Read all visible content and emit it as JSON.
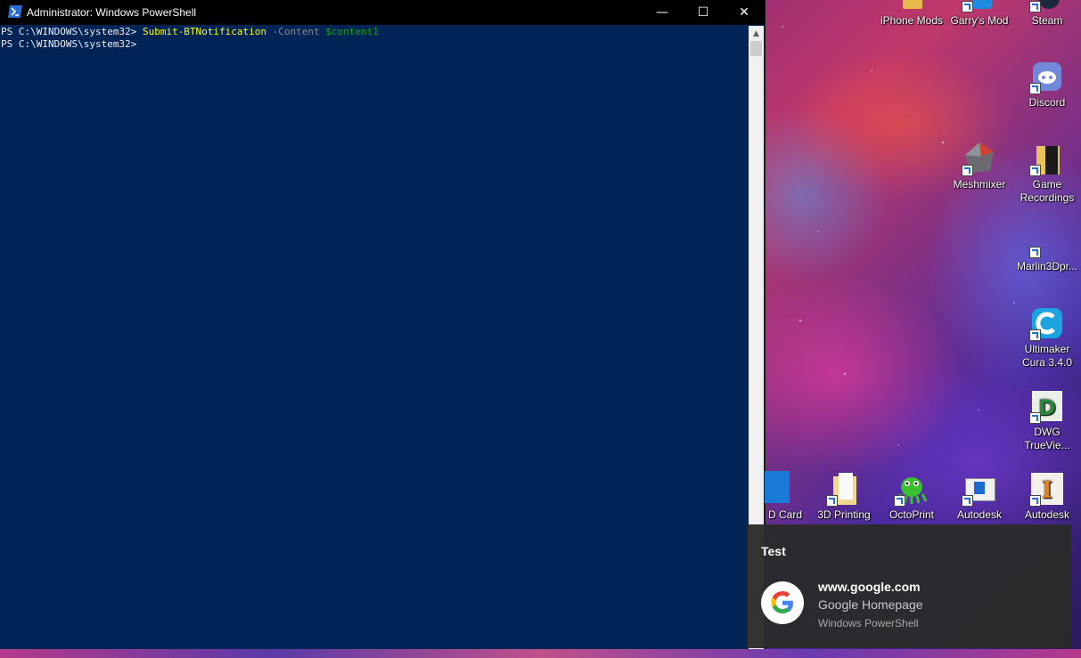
{
  "window": {
    "title": "Administrator: Windows PowerShell",
    "minimize": "—",
    "maximize": "☐",
    "close": "✕"
  },
  "console": {
    "line1": {
      "prompt": "PS C:\\WINDOWS\\system32> ",
      "command": "Submit-BTNotification",
      "param": " -Content ",
      "variable": "$content1"
    },
    "line2": {
      "prompt": "PS C:\\WINDOWS\\system32>"
    }
  },
  "desktop": {
    "icons": [
      {
        "label": "iPhone Mods"
      },
      {
        "label": "Garry's Mod"
      },
      {
        "label": "Steam"
      },
      {
        "label": "Discord"
      },
      {
        "label": "Meshmixer"
      },
      {
        "label": "Game Recordings"
      },
      {
        "label": "Marlin3Dpr..."
      },
      {
        "label": "Ultimaker Cura 3.4.0"
      },
      {
        "label": "DWG TrueVie..."
      },
      {
        "label": "D Card"
      },
      {
        "label": "3D Printing"
      },
      {
        "label": "OctoPrint"
      },
      {
        "label": "Autodesk"
      },
      {
        "label": "Autodesk"
      }
    ]
  },
  "toast": {
    "title": "Test",
    "heading": "www.google.com",
    "body": "Google Homepage",
    "attribution": "Windows PowerShell"
  },
  "colors": {
    "console_bg": "#012456",
    "command": "#ffff00",
    "parameter": "#8a8a8a",
    "variable": "#13a10e"
  }
}
